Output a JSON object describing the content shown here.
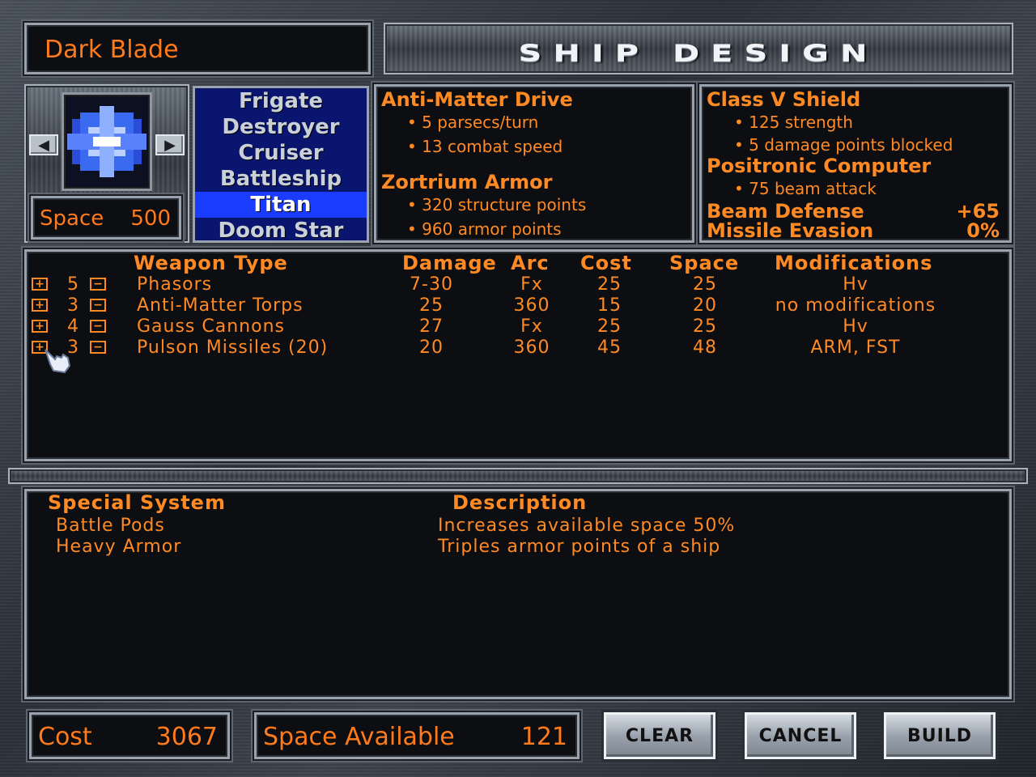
{
  "ship_name": "Dark Blade",
  "screen_title": "SHIP DESIGN",
  "space": {
    "label": "Space",
    "value": "500"
  },
  "hulls": [
    "Frigate",
    "Destroyer",
    "Cruiser",
    "Battleship",
    "Titan",
    "Doom Star"
  ],
  "selected_hull": "Titan",
  "drive": {
    "name": "Anti-Matter Drive",
    "bullets": [
      "5 parsecs/turn",
      "13 combat speed"
    ]
  },
  "armor": {
    "name": "Zortrium Armor",
    "bullets": [
      "320 structure points",
      "960 armor points"
    ]
  },
  "shield": {
    "name": "Class V Shield",
    "bullets": [
      "125 strength",
      "5 damage points blocked"
    ]
  },
  "computer": {
    "name": "Positronic Computer",
    "bullets": [
      "75 beam attack"
    ]
  },
  "beam_defense": {
    "label": "Beam Defense",
    "value": "+65"
  },
  "missile_evasion": {
    "label": "Missile Evasion",
    "value": "0%"
  },
  "weapons_headers": {
    "type": "Weapon Type",
    "damage": "Damage",
    "arc": "Arc",
    "cost": "Cost",
    "space": "Space",
    "mods": "Modifications"
  },
  "weapons": [
    {
      "count": "5",
      "name": "Phasors",
      "damage": "7-30",
      "arc": "Fx",
      "cost": "25",
      "space": "25",
      "mods": "Hv"
    },
    {
      "count": "3",
      "name": "Anti-Matter Torps",
      "damage": "25",
      "arc": "360",
      "cost": "15",
      "space": "20",
      "mods": "no modifications"
    },
    {
      "count": "4",
      "name": "Gauss Cannons",
      "damage": "27",
      "arc": "Fx",
      "cost": "25",
      "space": "25",
      "mods": "Hv"
    },
    {
      "count": "3",
      "name": "Pulson Missiles (20)",
      "damage": "20",
      "arc": "360",
      "cost": "45",
      "space": "48",
      "mods": "ARM, FST"
    }
  ],
  "specials_headers": {
    "system": "Special System",
    "description": "Description"
  },
  "specials": [
    {
      "name": "Battle Pods",
      "description": "Increases available space 50%"
    },
    {
      "name": "Heavy Armor",
      "description": "Triples armor points of a ship"
    }
  ],
  "cost": {
    "label": "Cost",
    "value": "3067"
  },
  "space_available": {
    "label": "Space Available",
    "value": "121"
  },
  "buttons": {
    "clear": "CLEAR",
    "cancel": "CANCEL",
    "build": "BUILD"
  },
  "colors": {
    "accent": "#ff8a24",
    "hull_bg": "#0a1570",
    "hull_selected": "#1a3cff"
  }
}
